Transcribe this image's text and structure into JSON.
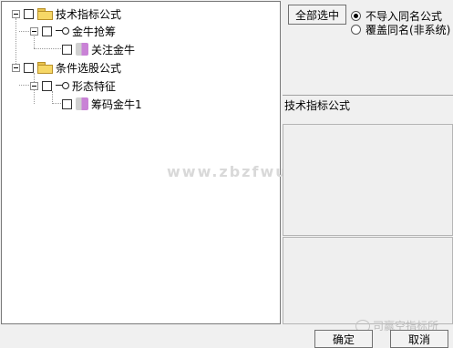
{
  "tree": {
    "items": [
      {
        "label": "技术指标公式"
      },
      {
        "label": "金牛抢筹"
      },
      {
        "label": "关注金牛"
      },
      {
        "label": "条件选股公式"
      },
      {
        "label": "形态特征"
      },
      {
        "label": "筹码金牛1"
      }
    ]
  },
  "controls": {
    "select_all_label": "全部选中",
    "radio_options": [
      {
        "label": "不导入同名公式",
        "selected": true
      },
      {
        "label": "覆盖同名(非系统)",
        "selected": false
      }
    ]
  },
  "right_panel": {
    "title": "技术指标公式"
  },
  "footer": {
    "ok_label": "确定",
    "cancel_label": "取消"
  },
  "watermark": {
    "text": "www.zbzfwu.com",
    "logo_text": "司赢空指标所"
  },
  "colors": {
    "folder": "#f6d766",
    "panel_bg": "#efefef",
    "window_bg": "#f0f0f0"
  }
}
